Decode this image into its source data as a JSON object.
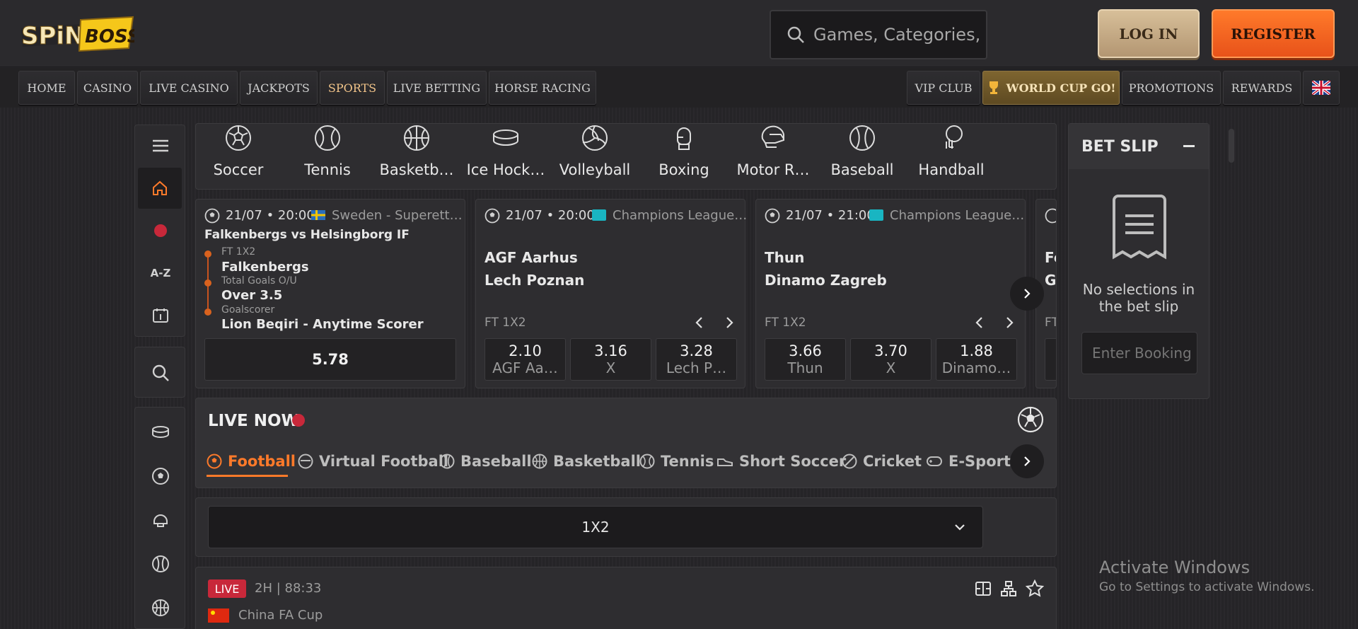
{
  "brand": {
    "logo_text_1": "SPiN",
    "logo_text_2": "BOSS"
  },
  "header": {
    "search_placeholder": "Games, Categories, Providers",
    "login_label": "LOG IN",
    "register_label": "REGISTER"
  },
  "nav": {
    "left": [
      "HOME",
      "CASINO",
      "LIVE CASINO",
      "JACKPOTS",
      "SPORTS",
      "LIVE BETTING",
      "HORSE RACING"
    ],
    "active": "SPORTS",
    "right": [
      "VIP CLUB",
      "WORLD CUP GO!",
      "PROMOTIONS",
      "REWARDS"
    ]
  },
  "sidebar": {
    "az_label": "A-Z"
  },
  "sports": [
    "Soccer",
    "Tennis",
    "Basketb…",
    "Ice Hock…",
    "Volleyball",
    "Boxing",
    "Motor R…",
    "Baseball",
    "Handball"
  ],
  "cards": [
    {
      "time": "21/07 • 20:00",
      "league": "Sweden - Superett…",
      "title": "Falkenbergs vs Helsingborg IF",
      "legs": [
        {
          "market": "FT 1X2",
          "pick": "Falkenbergs"
        },
        {
          "market": "Total Goals O/U",
          "pick": "Over 3.5"
        },
        {
          "market": "Goalscorer",
          "pick": "Lion Beqiri - Anytime Scorer"
        }
      ],
      "total_odds": "5.78"
    },
    {
      "time": "21/07 • 20:00",
      "league": "Champions League…",
      "home": "AGF Aarhus",
      "away": "Lech Poznan",
      "market": "FT 1X2",
      "odds": [
        {
          "v": "2.10",
          "l": "AGF Aa…"
        },
        {
          "v": "3.16",
          "l": "X"
        },
        {
          "v": "3.28",
          "l": "Lech P…"
        }
      ]
    },
    {
      "time": "21/07 • 21:00",
      "league": "Champions League…",
      "home": "Thun",
      "away": "Dinamo Zagreb",
      "market": "FT 1X2",
      "odds": [
        {
          "v": "3.66",
          "l": "Thun"
        },
        {
          "v": "3.70",
          "l": "X"
        },
        {
          "v": "1.88",
          "l": "Dinamo…"
        }
      ]
    },
    {
      "home": "Fe",
      "away": "G",
      "market": "FT"
    }
  ],
  "live_now": {
    "title": "LIVE NOW",
    "tabs": [
      "Football",
      "Virtual Football",
      "Baseball",
      "Basketball",
      "Tennis",
      "Short Soccer",
      "Cricket",
      "E-Sports"
    ],
    "active": "Football"
  },
  "market_select": {
    "value": "1X2"
  },
  "match": {
    "badge": "LIVE",
    "clock": "2H | 88:33",
    "competition": "China FA Cup"
  },
  "bet_slip": {
    "title": "BET SLIP",
    "empty_text_1": "No selections in",
    "empty_text_2": "the bet slip",
    "booking_placeholder": "Enter Booking"
  },
  "watermark": {
    "line1": "Activate Windows",
    "line2": "Go to Settings to activate Windows."
  }
}
